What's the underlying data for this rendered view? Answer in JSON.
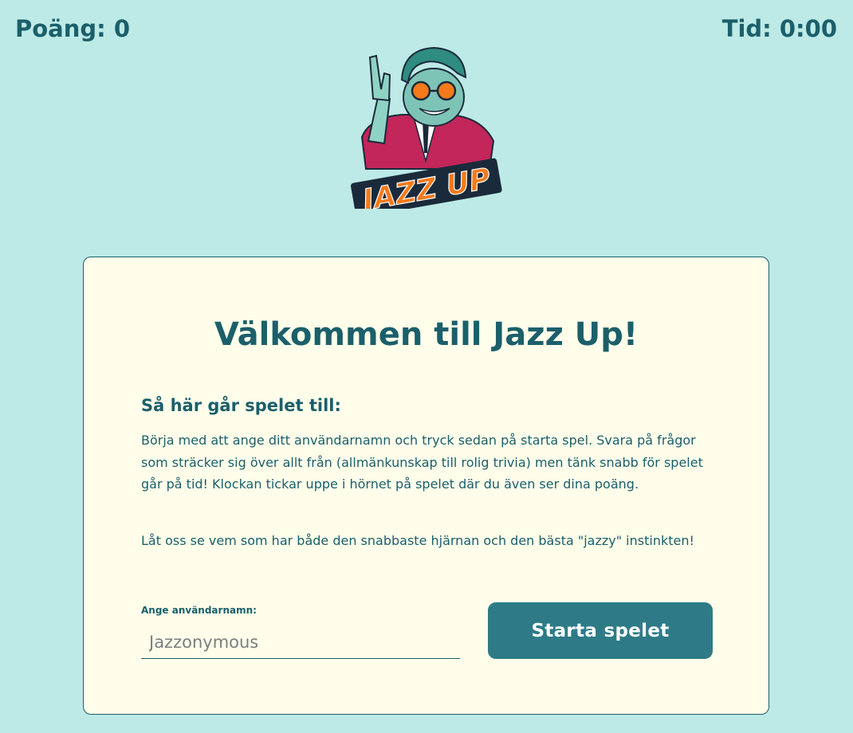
{
  "header": {
    "score": "Poäng: 0",
    "timer": "Tid: 0:00"
  },
  "logo": {
    "text": "JAZZ UP",
    "icon": "jazz-up-character-logo",
    "colors": {
      "orange": "#f47a1c",
      "jacket": "#c2265a",
      "skin": "#8fd3c4",
      "hair": "#2f8c80"
    }
  },
  "card": {
    "title": "Välkommen till Jazz Up!",
    "rules_heading": "Så här går spelet till:",
    "paragraph1": "Börja med att ange ditt användarnamn och tryck sedan på starta spel. Svara på frågor som sträcker sig över allt från (allmänkunskap till rolig trivia) men tänk snabb för spelet går på tid! Klockan tickar uppe i hörnet på spelet där du även ser dina poäng.",
    "paragraph2": "Låt oss se vem som har både den snabbaste hjärnan och den bästa \"jazzy\" instinkten!",
    "username_label": "Ange användarnamn:",
    "username_placeholder": "Jazzonymous",
    "username_value": "",
    "start_button": "Starta spelet"
  },
  "colors": {
    "background": "#bdeae6",
    "card_background": "#fefeea",
    "text": "#1b5f6b",
    "button": "#2e7b87"
  }
}
